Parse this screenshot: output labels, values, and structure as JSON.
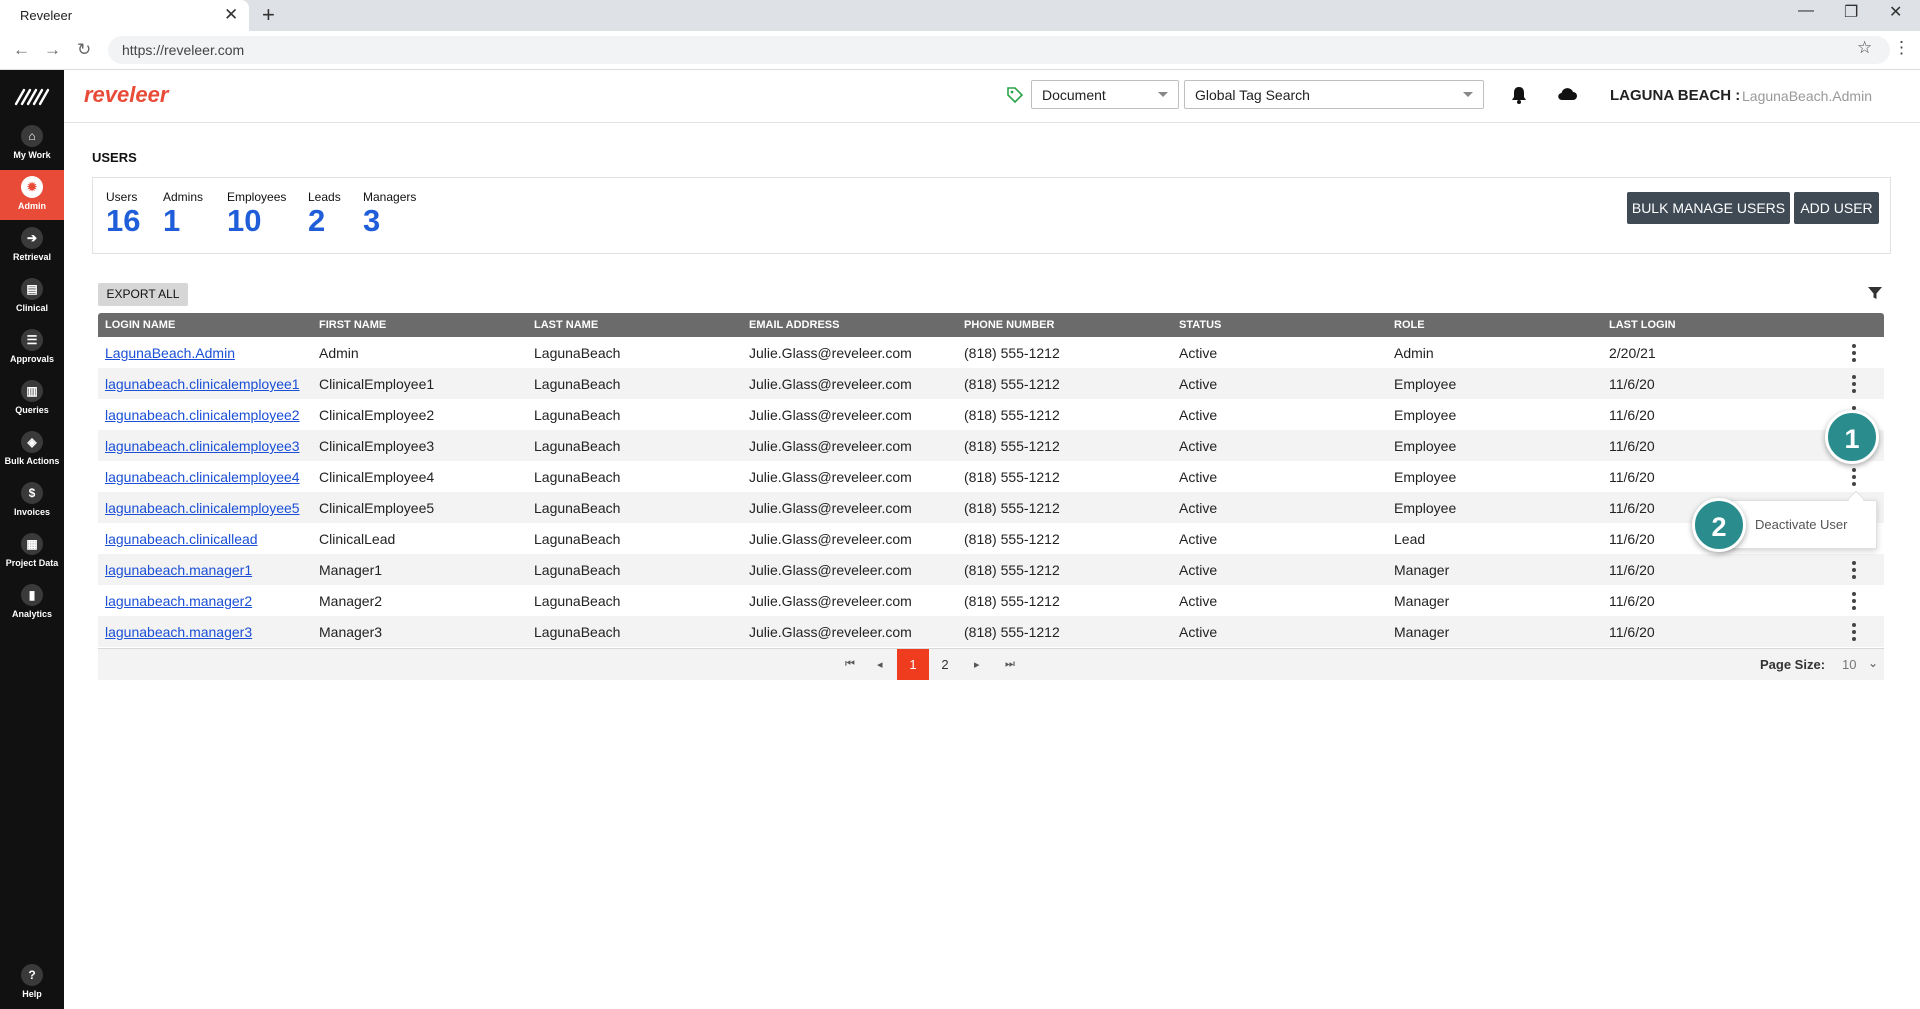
{
  "browser": {
    "tab_title": "Reveleer",
    "url": "https://reveleer.com"
  },
  "sidebar": {
    "items": [
      {
        "label": "My Work",
        "icon": "home-icon"
      },
      {
        "label": "Admin",
        "icon": "gear-icon"
      },
      {
        "label": "Retrieval",
        "icon": "arrow-right-icon"
      },
      {
        "label": "Clinical",
        "icon": "clipboard-icon"
      },
      {
        "label": "Approvals",
        "icon": "checklist-icon"
      },
      {
        "label": "Queries",
        "icon": "document-icon"
      },
      {
        "label": "Bulk Actions",
        "icon": "layers-icon"
      },
      {
        "label": "Invoices",
        "icon": "dollar-icon"
      },
      {
        "label": "Project Data",
        "icon": "project-icon"
      },
      {
        "label": "Analytics",
        "icon": "chart-icon"
      }
    ],
    "help_label": "Help",
    "active": "Admin"
  },
  "header": {
    "brand": "reveleer",
    "doc_select": "Document",
    "tag_search": "Global Tag Search",
    "org": "LAGUNA BEACH :",
    "user": "LagunaBeach.Admin"
  },
  "page": {
    "title": "USERS",
    "stats": [
      {
        "label": "Users",
        "value": "16"
      },
      {
        "label": "Admins",
        "value": "1"
      },
      {
        "label": "Employees",
        "value": "10"
      },
      {
        "label": "Leads",
        "value": "2"
      },
      {
        "label": "Managers",
        "value": "3"
      }
    ],
    "bulk_manage_label": "BULK MANAGE USERS",
    "add_user_label": "ADD USER",
    "export_label": "EXPORT ALL"
  },
  "grid": {
    "columns": [
      "LOGIN NAME",
      "FIRST NAME",
      "LAST NAME",
      "EMAIL ADDRESS",
      "PHONE NUMBER",
      "STATUS",
      "ROLE",
      "LAST LOGIN"
    ],
    "rows": [
      [
        "LagunaBeach.Admin",
        "Admin",
        "LagunaBeach",
        "Julie.Glass@reveleer.com",
        "(818) 555-1212",
        "Active",
        "Admin",
        "2/20/21"
      ],
      [
        "lagunabeach.clinicalemployee1",
        "ClinicalEmployee1",
        "LagunaBeach",
        "Julie.Glass@reveleer.com",
        "(818) 555-1212",
        "Active",
        "Employee",
        "11/6/20"
      ],
      [
        "lagunabeach.clinicalemployee2",
        "ClinicalEmployee2",
        "LagunaBeach",
        "Julie.Glass@reveleer.com",
        "(818) 555-1212",
        "Active",
        "Employee",
        "11/6/20"
      ],
      [
        "lagunabeach.clinicalemployee3",
        "ClinicalEmployee3",
        "LagunaBeach",
        "Julie.Glass@reveleer.com",
        "(818) 555-1212",
        "Active",
        "Employee",
        "11/6/20"
      ],
      [
        "lagunabeach.clinicalemployee4",
        "ClinicalEmployee4",
        "LagunaBeach",
        "Julie.Glass@reveleer.com",
        "(818) 555-1212",
        "Active",
        "Employee",
        "11/6/20"
      ],
      [
        "lagunabeach.clinicalemployee5",
        "ClinicalEmployee5",
        "LagunaBeach",
        "Julie.Glass@reveleer.com",
        "(818) 555-1212",
        "Active",
        "Employee",
        "11/6/20"
      ],
      [
        "lagunabeach.clinicallead",
        "ClinicalLead",
        "LagunaBeach",
        "Julie.Glass@reveleer.com",
        "(818) 555-1212",
        "Active",
        "Lead",
        "11/6/20"
      ],
      [
        "lagunabeach.manager1",
        "Manager1",
        "LagunaBeach",
        "Julie.Glass@reveleer.com",
        "(818) 555-1212",
        "Active",
        "Manager",
        "11/6/20"
      ],
      [
        "lagunabeach.manager2",
        "Manager2",
        "LagunaBeach",
        "Julie.Glass@reveleer.com",
        "(818) 555-1212",
        "Active",
        "Manager",
        "11/6/20"
      ],
      [
        "lagunabeach.manager3",
        "Manager3",
        "LagunaBeach",
        "Julie.Glass@reveleer.com",
        "(818) 555-1212",
        "Active",
        "Manager",
        "11/6/20"
      ]
    ]
  },
  "pager": {
    "pages": [
      "1",
      "2"
    ],
    "current": "1",
    "page_size_label": "Page Size:",
    "page_size": "10"
  },
  "popup": {
    "deactivate_label": "Deactivate User"
  },
  "callouts": [
    "1",
    "2"
  ],
  "colors": {
    "accent": "#e84b37",
    "link": "#1a4fd6",
    "stat": "#1f5ed8",
    "callout": "#2a8c8c"
  }
}
